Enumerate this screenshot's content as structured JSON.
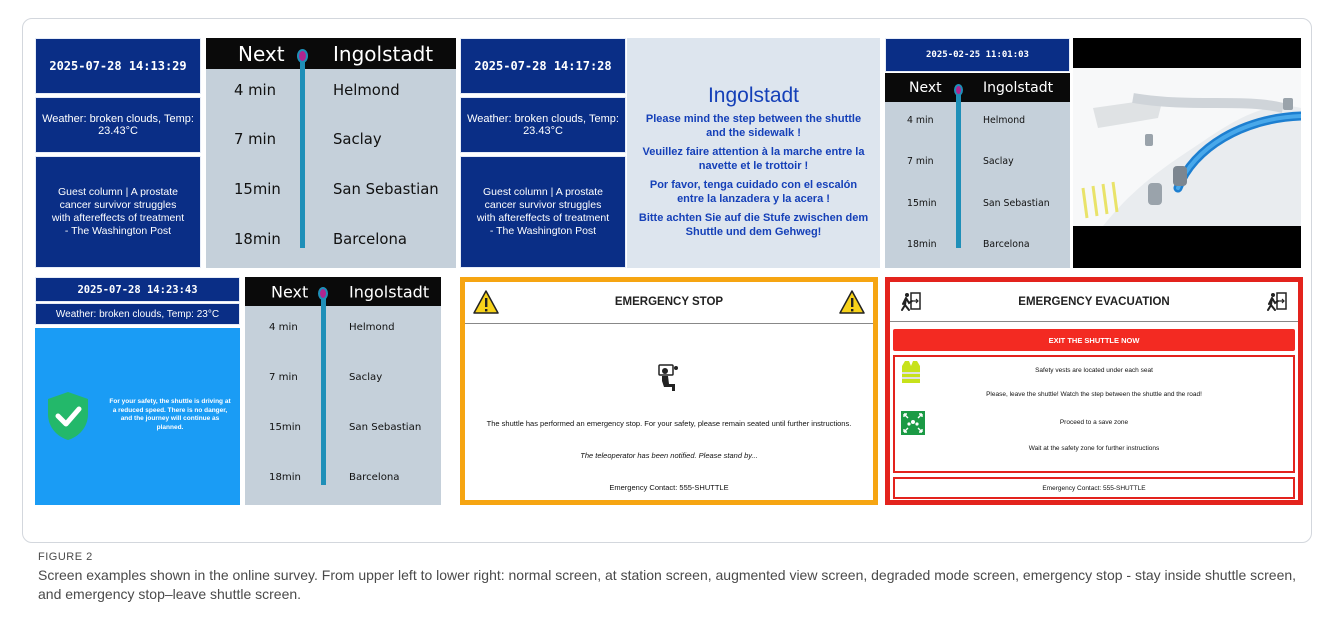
{
  "figure": {
    "label": "FIGURE 2",
    "caption": "Screen examples shown in the online survey. From upper left to lower right: normal screen, at station screen, augmented view screen, degraded mode screen, emergency stop - stay inside shuttle screen, and emergency stop–leave shuttle screen."
  },
  "timeline": {
    "next_label": "Next",
    "destination": "Ingolstadt",
    "stops": [
      {
        "eta": "4 min",
        "name": "Helmond"
      },
      {
        "eta": "7 min",
        "name": "Saclay"
      },
      {
        "eta": "15min",
        "name": "San Sebastian"
      },
      {
        "eta": "18min",
        "name": "Barcelona"
      }
    ]
  },
  "normal": {
    "date": "2025-07-28  14:13:29",
    "weather": "Weather: broken clouds, Temp: 23.43°C",
    "news": "Guest column | A prostate cancer survivor struggles with aftereffects of treatment - The Washington Post"
  },
  "station": {
    "date": "2025-07-28  14:17:28",
    "weather": "Weather: broken clouds, Temp: 23.43°C",
    "news": "Guest column | A prostate cancer survivor struggles with aftereffects of treatment - The Washington Post",
    "title": "Ingolstadt",
    "messages": [
      "Please mind the step between the shuttle and the sidewalk !",
      "Veuillez faire attention à la marche entre la navette et le trottoir !",
      "Por favor, tenga cuidado con el escalón entre la lanzadera y la acera !",
      "Bitte achten Sie auf die Stufe zwischen dem Shuttle und dem Gehweg!"
    ]
  },
  "augmented": {
    "date": "2025-02-25  11:01:03"
  },
  "degraded": {
    "date": "2025-07-28  14:23:43",
    "weather": "Weather: broken clouds, Temp: 23°C",
    "safety_msg": "For your safety, the shuttle is driving at a reduced speed. There is no danger, and the journey will continue as planned."
  },
  "estop": {
    "title": "EMERGENCY STOP",
    "msg1": "The shuttle has performed an emergency stop. For your safety, please remain seated until further instructions.",
    "msg2": "The teleoperator has been notified. Please stand by...",
    "contact": "Emergency Contact: 555-SHUTTLE",
    "colors": {
      "border": "#f6a512",
      "warning": "#f7d21a"
    }
  },
  "evac": {
    "title": "EMERGENCY EVACUATION",
    "exit_label": "EXIT THE SHUTTLE NOW",
    "vest_text": "Safety vests are located under each seat",
    "leave_text": "Please, leave the shuttle! Watch the step between the shuttle and the road!",
    "zone_text": "Proceed to a save zone",
    "wait_text": "Wait at the safety zone for further instructions",
    "contact": "Emergency Contact: 555-SHUTTLE",
    "colors": {
      "border": "#e3231d",
      "vest": "#c7e21b",
      "zone": "#1b9a45"
    }
  }
}
